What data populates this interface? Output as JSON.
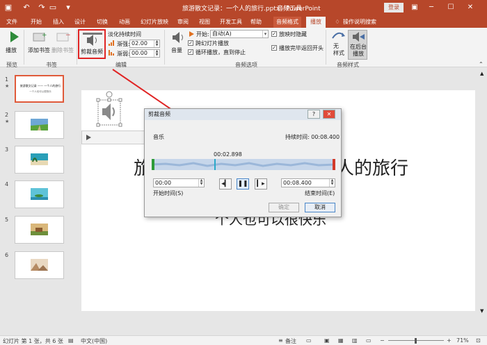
{
  "titlebar": {
    "title": "旅游散文记录：一个人的旅行.pptx - PowerPoint",
    "context_tab_group": "音频工具",
    "login": "登录"
  },
  "tabs": [
    {
      "label": "文件"
    },
    {
      "label": "开始"
    },
    {
      "label": "插入"
    },
    {
      "label": "设计"
    },
    {
      "label": "切换"
    },
    {
      "label": "动画"
    },
    {
      "label": "幻灯片放映"
    },
    {
      "label": "审阅"
    },
    {
      "label": "视图"
    },
    {
      "label": "开发工具"
    },
    {
      "label": "帮助"
    },
    {
      "label": "音频格式"
    },
    {
      "label": "播放"
    }
  ],
  "tell_me": "操作说明搜索",
  "ribbon": {
    "preview_group": "预览",
    "play": "播放",
    "bookmark_group": "书签",
    "add_bookmark": "添加书签",
    "remove_bookmark": "删除书签",
    "editing_group": "编辑",
    "clip_audio": "剪裁音频",
    "fade_duration": "淡化持续时间",
    "fade_in_label": "渐强:",
    "fade_in_value": "02.00",
    "fade_out_label": "渐弱:",
    "fade_out_value": "00.00",
    "volume": "音量",
    "start_label": "开始:",
    "start_value": "自动(A)",
    "play_across_slides": "跨幻灯片播放",
    "loop_until_stopped": "循环播放，直到停止",
    "hide_during_show": "放映时隐藏",
    "rewind_after_playing": "播放完毕返回开头",
    "audio_options_group": "音频选项",
    "no_style": "无\n样式",
    "play_in_background": "在后台\n播放",
    "audio_styles_group": "音频样式"
  },
  "slides": [
    {
      "num": "1",
      "star": "★",
      "title": "旅游散文记录 —— 一个人的旅行",
      "subtitle": "一个人也可以很快乐"
    },
    {
      "num": "2",
      "star": "★"
    },
    {
      "num": "3",
      "star": ""
    },
    {
      "num": "4",
      "star": ""
    },
    {
      "num": "5",
      "star": ""
    },
    {
      "num": "6",
      "star": ""
    }
  ],
  "slide_main": {
    "title_left": "旅",
    "title_right": "人的旅行",
    "subtitle": "个人也可以很快乐"
  },
  "dialog": {
    "title": "剪裁音频",
    "help": "?",
    "close": "✕",
    "file_name": "音乐",
    "duration_label": "持续时间: 00:08.400",
    "current_time": "00:02.898",
    "start_time_value": "00:00",
    "start_time_label": "开始时间(S)",
    "end_time_value": "00:08.400",
    "end_time_label": "结束时间(E)",
    "ok": "确定",
    "cancel": "取消"
  },
  "statusbar": {
    "slide_info": "幻灯片 第 1 张，共 6 张",
    "language": "中文(中国)",
    "notes": "备注",
    "zoom_value": "71%"
  },
  "colors": {
    "accent": "#b7472a",
    "highlight_box": "#e02424",
    "selected_thumb": "#e05a3a"
  }
}
